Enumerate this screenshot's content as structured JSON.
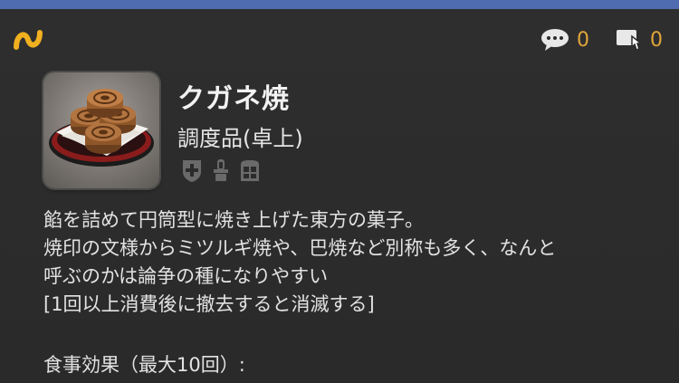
{
  "header": {
    "brand_icon": "lodestone-n-icon",
    "comments": {
      "icon": "speech-bubble-icon",
      "count": "0"
    },
    "posts": {
      "icon": "hand-pointer-icon",
      "count": "0"
    }
  },
  "item": {
    "name": "クガネ焼",
    "category": "調度品(卓上)",
    "thumbnail": "kugane-yaki-pastry-image",
    "flags": [
      "armoire-icon",
      "dye-icon",
      "housing-icon"
    ],
    "description": [
      "餡を詰めて円筒型に焼き上げた東方の菓子。",
      "焼印の文様からミツルギ焼や、巴焼など別称も多く、なんと",
      "呼ぶのかは論争の種になりやすい",
      "[1回以上消費後に撤去すると消滅する]"
    ],
    "effect_heading": "食事効果（最大10回）:"
  },
  "colors": {
    "top_strip": "#4f6cb0",
    "background": "#2b2b2b",
    "counter": "#e0a53a",
    "brand": "#f0b020"
  }
}
